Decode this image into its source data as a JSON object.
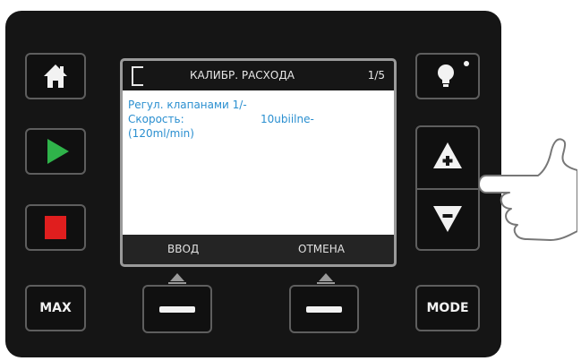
{
  "screen": {
    "header_title": "КАЛИБР. РАСХОДА",
    "header_page": "1/5",
    "body_line1": "Регул. клапанами 1/-",
    "body_line2_label": "Скорость:",
    "body_line2_value": "10ubiilne-",
    "body_line3": "(120ml/min)",
    "softkey_left_label": "ВВОД",
    "softkey_right_label": "ОТМЕНА"
  },
  "keys": {
    "max_label": "MAX",
    "mode_label": "MODE"
  },
  "colors": {
    "device_body": "#151515",
    "key_border": "#5e5e5e",
    "play_green": "#2fb34a",
    "stop_red": "#e01e1e",
    "screen_text_blue": "#2a8fd0"
  },
  "icons": {
    "home": "home-icon",
    "play": "play-icon",
    "stop": "stop-icon",
    "light": "lightbulb-icon",
    "up": "arrow-up-plus-icon",
    "down": "arrow-down-minus-icon",
    "hand": "pointing-hand-icon"
  }
}
